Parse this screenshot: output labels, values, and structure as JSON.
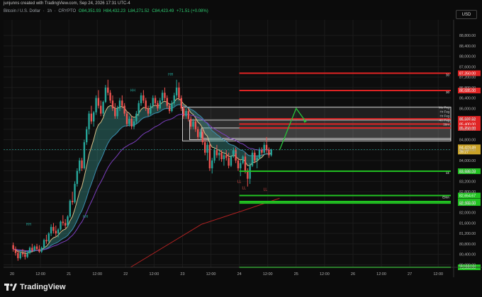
{
  "header": {
    "credit": "junjunns created with TradingView.com, Sep 24, 2026 17:31 UTC-4",
    "symbol": "Bitcoin / U.S. Dollar",
    "interval": "1h",
    "exchange": "CRYPTO",
    "ohlc": {
      "open": "O84,351.93",
      "high": "H84,432.23",
      "low": "L84,271.52",
      "close": "C84,423.49",
      "change": "+71.51 (+0.08%)"
    },
    "currency": "USD"
  },
  "footer": {
    "logo_text": "TradingView"
  },
  "chart_data": {
    "type": "candlestick",
    "y_range": [
      79900,
      89400
    ],
    "y_ticks": [
      80000,
      80400,
      80800,
      81200,
      81600,
      82000,
      82400,
      82800,
      83200,
      83600,
      84000,
      84400,
      84800,
      85200,
      85600,
      86000,
      86400,
      86800,
      87200,
      87600,
      88000,
      88400,
      88800
    ],
    "y_tick_labels": [
      "80,000.00",
      "80,400.00",
      "80,800.00",
      "81,200.00",
      "81,600.00",
      "82,000.00",
      "82,400.00",
      "82,800.00",
      "83,200.00",
      "83,600.00",
      "84,000.00",
      "84,400.00",
      "84,800.00",
      "85,200.00",
      "85,600.00",
      "86,000.00",
      "86,400.00",
      "86,800.00",
      "87,200.00",
      "87,600.00",
      "88,000.00",
      "88,400.00",
      "88,800.00"
    ],
    "x_labels": [
      "20",
      "12:00",
      "21",
      "12:00",
      "22",
      "12:00",
      "23",
      "12:00",
      "24",
      "12:00",
      "25",
      "12:00",
      "26",
      "12:00",
      "27",
      "12:00"
    ],
    "x_label_hours": [
      0,
      12,
      24,
      36,
      48,
      60,
      72,
      84,
      96,
      108,
      120,
      132,
      144,
      156,
      168,
      180
    ],
    "candles_start_hour": 0,
    "candles": [
      [
        80750,
        80850,
        80500,
        80600
      ],
      [
        80600,
        80700,
        80350,
        80450
      ],
      [
        80450,
        80550,
        80150,
        80250
      ],
      [
        80250,
        80500,
        80200,
        80450
      ],
      [
        80450,
        80600,
        80300,
        80400
      ],
      [
        80400,
        80550,
        80200,
        80300
      ],
      [
        80300,
        80500,
        80250,
        80450
      ],
      [
        80450,
        80700,
        80400,
        80650
      ],
      [
        80650,
        80800,
        80500,
        80550
      ],
      [
        80550,
        80750,
        80500,
        80700
      ],
      [
        80700,
        80800,
        80550,
        80600
      ],
      [
        80600,
        80750,
        80450,
        80500
      ],
      [
        80500,
        80700,
        80450,
        80650
      ],
      [
        80650,
        81000,
        80600,
        80950
      ],
      [
        80950,
        81150,
        80800,
        80900
      ],
      [
        80900,
        81250,
        80850,
        81200
      ],
      [
        81200,
        81550,
        81100,
        81450
      ],
      [
        81450,
        81600,
        81200,
        81300
      ],
      [
        81300,
        81500,
        81100,
        81200
      ],
      [
        81200,
        81400,
        81050,
        81350
      ],
      [
        81350,
        81700,
        81300,
        81650
      ],
      [
        81650,
        81900,
        81500,
        81600
      ],
      [
        81600,
        81750,
        81400,
        81500
      ],
      [
        81500,
        81900,
        81450,
        81850
      ],
      [
        81850,
        82500,
        81800,
        82450
      ],
      [
        82450,
        82800,
        82300,
        82400
      ],
      [
        82400,
        83200,
        82350,
        83100
      ],
      [
        83100,
        83700,
        83000,
        83600
      ],
      [
        83600,
        84100,
        83500,
        84000
      ],
      [
        84000,
        84100,
        83600,
        83700
      ],
      [
        83700,
        84800,
        83650,
        84700
      ],
      [
        84700,
        85300,
        84600,
        85200
      ],
      [
        85200,
        85900,
        85000,
        85800
      ],
      [
        85800,
        86100,
        85400,
        85500
      ],
      [
        85500,
        85900,
        85300,
        85850
      ],
      [
        85850,
        86500,
        85750,
        86400
      ],
      [
        86400,
        86700,
        86000,
        86100
      ],
      [
        86100,
        86300,
        85700,
        85800
      ],
      [
        85800,
        86300,
        85700,
        86250
      ],
      [
        86250,
        86900,
        86200,
        86800
      ],
      [
        86800,
        87100,
        86500,
        86600
      ],
      [
        86600,
        86700,
        86200,
        86300
      ],
      [
        86300,
        86500,
        85900,
        86000
      ],
      [
        86000,
        86200,
        85600,
        85700
      ],
      [
        85700,
        86100,
        85600,
        86000
      ],
      [
        86000,
        86400,
        85900,
        86300
      ],
      [
        86300,
        86500,
        86000,
        86100
      ],
      [
        86100,
        86200,
        85700,
        85800
      ],
      [
        85800,
        85900,
        85300,
        85400
      ],
      [
        85400,
        85700,
        85300,
        85600
      ],
      [
        85600,
        85700,
        85200,
        85300
      ],
      [
        85300,
        85600,
        85200,
        85500
      ],
      [
        85500,
        85900,
        85400,
        85800
      ],
      [
        85800,
        86300,
        85700,
        86200
      ],
      [
        86200,
        86600,
        86100,
        86500
      ],
      [
        86500,
        86700,
        86200,
        86300
      ],
      [
        86300,
        86400,
        85900,
        86000
      ],
      [
        86000,
        86100,
        85700,
        85800
      ],
      [
        85800,
        86200,
        85750,
        86100
      ],
      [
        86100,
        86500,
        86000,
        86400
      ],
      [
        86400,
        86500,
        86100,
        86200
      ],
      [
        86200,
        86300,
        85900,
        86000
      ],
      [
        86000,
        86400,
        85950,
        86300
      ],
      [
        86300,
        86700,
        86200,
        86600
      ],
      [
        86600,
        86800,
        86300,
        86400
      ],
      [
        86400,
        86500,
        86000,
        86100
      ],
      [
        86100,
        86200,
        85800,
        85900
      ],
      [
        85900,
        86300,
        85850,
        86200
      ],
      [
        86200,
        86600,
        86100,
        86500
      ],
      [
        86500,
        87100,
        86400,
        86800
      ],
      [
        86800,
        87000,
        86300,
        86400
      ],
      [
        86400,
        86500,
        85900,
        86000
      ],
      [
        86000,
        86100,
        85600,
        85700
      ],
      [
        85700,
        86000,
        85600,
        85900
      ],
      [
        85900,
        86000,
        85500,
        85600
      ],
      [
        85600,
        85700,
        85200,
        85300
      ],
      [
        85300,
        85600,
        85200,
        85500
      ],
      [
        85500,
        85600,
        85100,
        85200
      ],
      [
        85200,
        85300,
        84800,
        84900
      ],
      [
        84900,
        85200,
        84800,
        85100
      ],
      [
        85100,
        85200,
        84600,
        84700
      ],
      [
        84700,
        84800,
        84200,
        84300
      ],
      [
        84300,
        84700,
        84000,
        84600
      ],
      [
        84600,
        84700,
        83600,
        83700
      ],
      [
        83700,
        84100,
        83500,
        84000
      ],
      [
        84000,
        84500,
        83900,
        84400
      ],
      [
        84400,
        84600,
        84100,
        84200
      ],
      [
        84200,
        84400,
        84000,
        84300
      ],
      [
        84300,
        84400,
        83950,
        84050
      ],
      [
        84050,
        84300,
        83800,
        84200
      ],
      [
        84200,
        84400,
        84000,
        84100
      ],
      [
        84100,
        84300,
        83700,
        83800
      ],
      [
        83800,
        84200,
        83750,
        84150
      ],
      [
        84150,
        84500,
        84100,
        84400
      ],
      [
        84400,
        84500,
        83900,
        84000
      ],
      [
        84000,
        84100,
        83600,
        83700
      ],
      [
        83700,
        84000,
        83400,
        83900
      ],
      [
        83900,
        84200,
        83850,
        84150
      ],
      [
        84150,
        84300,
        83500,
        83600
      ],
      [
        83600,
        83700,
        83000,
        83300
      ],
      [
        83300,
        83900,
        83100,
        83800
      ],
      [
        83800,
        84400,
        83750,
        84300
      ],
      [
        84300,
        84400,
        83900,
        84000
      ],
      [
        84000,
        84200,
        83700,
        84100
      ],
      [
        84100,
        84500,
        84050,
        84400
      ],
      [
        84400,
        84500,
        84200,
        84300
      ],
      [
        84300,
        84700,
        84250,
        84600
      ],
      [
        84600,
        84900,
        84300,
        84400
      ],
      [
        84400,
        84500,
        84100,
        84200
      ],
      [
        84200,
        84450,
        84150,
        84423
      ]
    ],
    "price_lines": [
      {
        "price": 87350,
        "label": "87,350.00",
        "color": "#e02424",
        "tag": "30"
      },
      {
        "price": 86685,
        "label": "86,685.00",
        "color": "#e02424",
        "tag": "30"
      },
      {
        "price": 85597.52,
        "label": "85,597.52",
        "color": "#e02424",
        "tag": ""
      },
      {
        "price": 85400,
        "label": "85,400.00",
        "color": "#e02424",
        "tag": ""
      },
      {
        "price": 85250,
        "label": "85,250.00",
        "color": "#e02424",
        "tag": ""
      },
      {
        "price": 83588.03,
        "label": "83,588.03",
        "color": "#22c322",
        "tag": "1Σ"
      },
      {
        "price": 82654.67,
        "label": "82,654.67",
        "color": "#22c322",
        "tag": "EMA"
      },
      {
        "price": 82424,
        "label": "82,424.00",
        "color": "#22c322",
        "tag": ""
      },
      {
        "price": 82368,
        "label": "82,368.00",
        "color": "#22c322",
        "tag": ""
      },
      {
        "price": 79900,
        "label": "79,900.00",
        "color": "#22c322",
        "tag": ""
      }
    ],
    "last_price": {
      "price": 84423.49,
      "label": "84,423.49",
      "countdown": "28:27"
    },
    "zones": [
      {
        "from_hour": 72,
        "to_hour": 190,
        "low": 84750,
        "high": 86050
      },
      {
        "from_hour": 75,
        "to_hour": 190,
        "low": 84800,
        "high": 85550
      },
      {
        "from_hour": 80,
        "to_hour": 190,
        "low": 84850,
        "high": 85250
      }
    ],
    "projection": [
      [
        113,
        84400
      ],
      [
        120,
        86000
      ],
      [
        124,
        85500
      ]
    ],
    "pivot_labels": [
      {
        "text": "HH",
        "hour": 7,
        "price": 81500
      },
      {
        "text": "HH",
        "hour": 31,
        "price": 81800
      },
      {
        "text": "HH",
        "hour": 51,
        "price": 86650
      },
      {
        "text": "HH",
        "hour": 67,
        "price": 87250
      },
      {
        "text": "HH",
        "hour": 94,
        "price": 84250
      },
      {
        "text": "LL",
        "hour": 96,
        "price": 83150
      },
      {
        "text": "LL",
        "hour": 98,
        "price": 82900
      },
      {
        "text": "LL",
        "hour": 107,
        "price": 82850
      }
    ],
    "sidebar_labels": [
      "Mo Fvg",
      "Hr Fvg",
      "Hr Fvg",
      "4H Fvg",
      "30m"
    ],
    "ema_start": [
      [
        50,
        79900
      ],
      [
        80,
        81550
      ],
      [
        100,
        82150
      ],
      [
        113,
        82550
      ]
    ]
  }
}
